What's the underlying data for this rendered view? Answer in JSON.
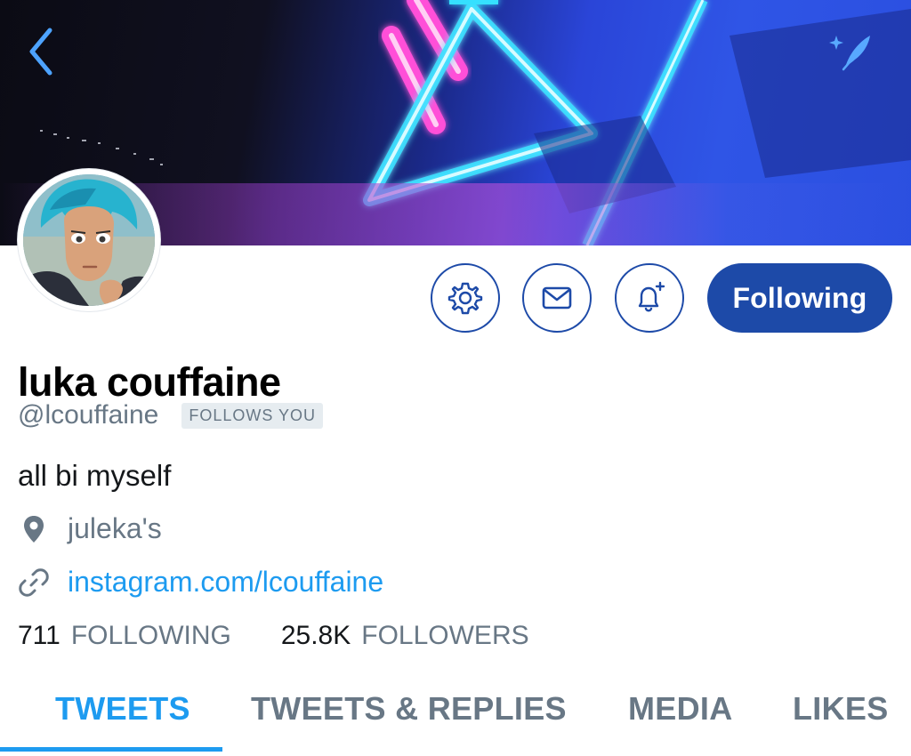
{
  "header": {
    "back_icon": "chevron-left-icon",
    "compose_icon": "sparkle-feather-icon"
  },
  "profile": {
    "display_name": "luka couffaine",
    "handle": "@lcouffaine",
    "follows_you_badge": "FOLLOWS YOU",
    "bio": "all bi myself",
    "location": "juleka's",
    "website": "instagram.com/lcouffaine"
  },
  "actions": {
    "settings_icon": "gear-icon",
    "message_icon": "envelope-icon",
    "notify_icon": "bell-plus-icon",
    "following_label": "Following"
  },
  "stats": {
    "following_count": "711",
    "following_label": "FOLLOWING",
    "followers_count": "25.8K",
    "followers_label": "FOLLOWERS"
  },
  "tabs": [
    {
      "label": "TWEETS",
      "active": true
    },
    {
      "label": "TWEETS & REPLIES",
      "active": false
    },
    {
      "label": "MEDIA",
      "active": false
    },
    {
      "label": "LIKES",
      "active": false
    }
  ],
  "colors": {
    "accent_blue": "#1d9bf0",
    "button_navy": "#1d4aa8",
    "muted_text": "#687785"
  }
}
